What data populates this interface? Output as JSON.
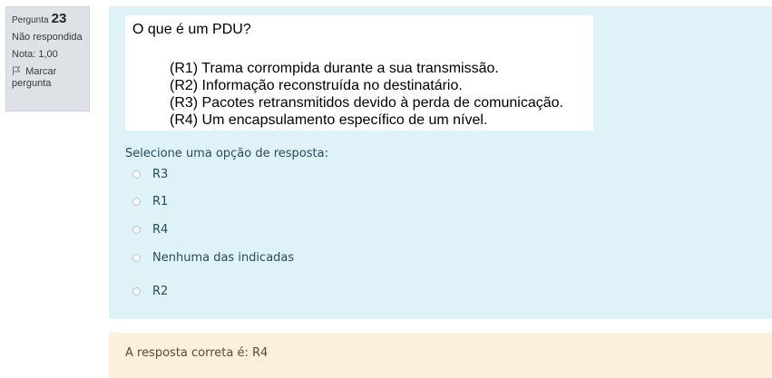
{
  "info": {
    "question_label": "Pergunta",
    "question_number": "23",
    "status": "Não respondida",
    "grade": "Nota: 1,00",
    "flag_line1": "Marcar",
    "flag_line2": "pergunta"
  },
  "question": {
    "title": "O que é um PDU?",
    "options": [
      "(R1)  Trama corrompida durante a sua transmissão.",
      "(R2)  Informação reconstruída no destinatário.",
      "(R3)  Pacotes retransmitidos devido à perda de comunicação.",
      "(R4)  Um encapsulamento específico de um nível."
    ],
    "prompt": "Selecione uma opção de resposta:",
    "answers": [
      "R3",
      "R1",
      "R4",
      "Nenhuma das indicadas",
      "R2"
    ]
  },
  "feedback": {
    "text": "A resposta correta é: R4"
  },
  "icons": {
    "flag": "flag-icon"
  },
  "colors": {
    "content_bg": "#def2f8",
    "feedback_bg": "#fcefdc",
    "info_bg": "#dee2e6"
  }
}
